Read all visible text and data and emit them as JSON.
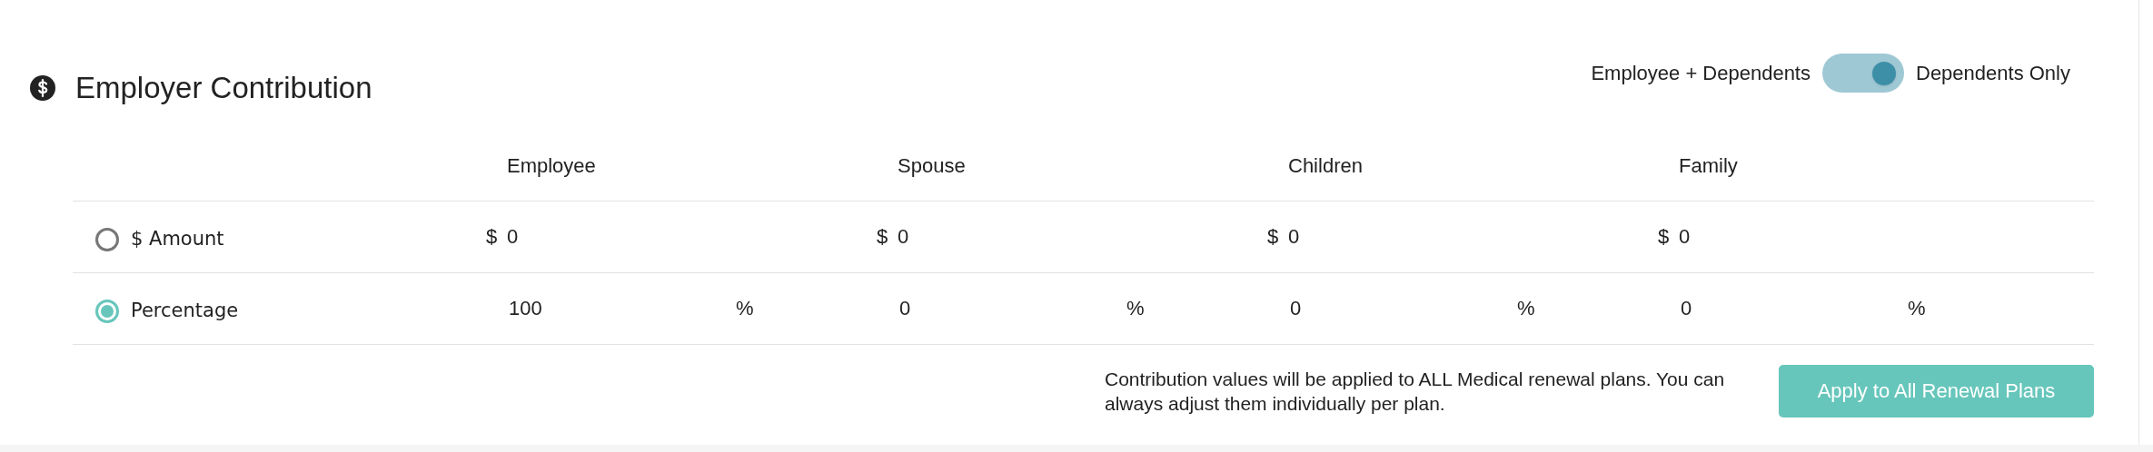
{
  "section": {
    "title": "Employer Contribution"
  },
  "toggle": {
    "left_label": "Employee + Dependents",
    "right_label": "Dependents Only",
    "on": true
  },
  "columns": [
    "Employee",
    "Spouse",
    "Children",
    "Family"
  ],
  "rows": [
    {
      "kind": "amount",
      "label": "$ Amount",
      "selected": false,
      "prefix": "$",
      "values": [
        "0",
        "0",
        "0",
        "0"
      ]
    },
    {
      "kind": "percentage",
      "label": "Percentage",
      "selected": true,
      "unit": "%",
      "values": [
        "100",
        "0",
        "0",
        "0"
      ]
    }
  ],
  "note": "Contribution values will be applied to ALL Medical renewal plans. You can always adjust them individually per plan.",
  "apply_button": "Apply to All Renewal Plans"
}
